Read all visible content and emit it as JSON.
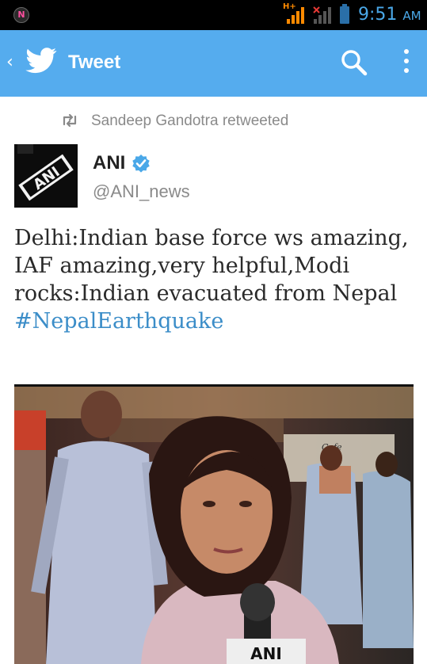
{
  "status_bar": {
    "app_icon": "N",
    "network_label": "H+",
    "time": "9:51",
    "ampm": "AM",
    "icons": [
      "signal-icon",
      "no-signal-icon",
      "battery-icon"
    ]
  },
  "app_bar": {
    "title": "Tweet",
    "icons": [
      "back-icon",
      "twitter-bird-icon",
      "search-icon",
      "overflow-menu-icon"
    ]
  },
  "tweet": {
    "retweeted_by": "Sandeep Gandotra retweeted",
    "author": {
      "name": "ANI",
      "handle": "@ANI_news",
      "verified": true,
      "avatar_text": "ANI"
    },
    "text": "Delhi:Indian base force ws amazing, IAF amazing,very helpful,Modi rocks:Indian evacuated from Nepal",
    "hashtag": "#NepalEarthquake",
    "media": {
      "description_icon": "photo",
      "badge_text": "ANI",
      "cafe_sign": "Cafe"
    }
  },
  "colors": {
    "twitter_blue": "#55acee",
    "link": "#3b8dc8",
    "clock": "#4aa8e8"
  }
}
